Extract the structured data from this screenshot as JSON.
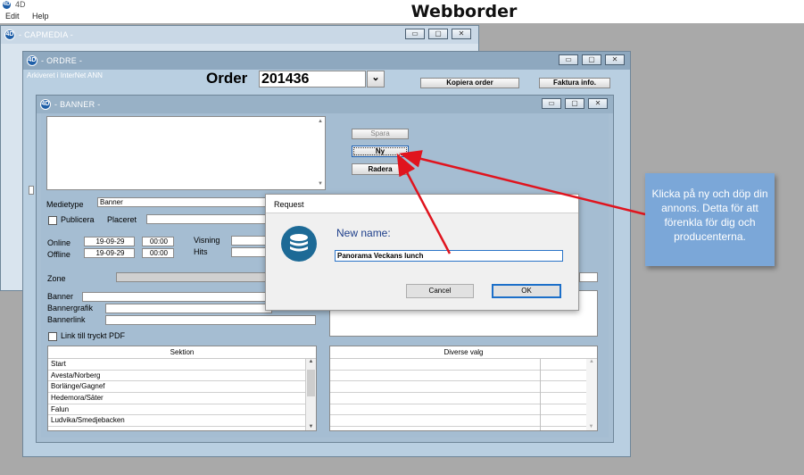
{
  "app": {
    "icon_glyph": "4D",
    "name": "4D",
    "menu": [
      "Edit",
      "Help"
    ]
  },
  "page_title": "Webborder",
  "windows": {
    "capmedia": {
      "title": "- CAPMEDIA -"
    },
    "ordre": {
      "title": "- ORDRE -",
      "archived_label": "Arkiveret i InterNet ANN",
      "order_label": "Order",
      "order_number": "201436",
      "copy_button": "Kopiera order",
      "invoice_button": "Faktura info."
    },
    "banner": {
      "title": "- BANNER -",
      "save_button": "Spara",
      "new_button": "Ny",
      "delete_button": "Radera",
      "medietype_label": "Medietype",
      "medietype_value": "Banner",
      "publicera_label": "Publicera",
      "placeret_label": "Placeret",
      "online_label": "Online",
      "offline_label": "Offline",
      "online_date": "19-09-29",
      "online_time": "00:00",
      "offline_date": "19-09-29",
      "offline_time": "00:00",
      "visning_label": "Visning",
      "hits_label": "Hits",
      "zone_label": "Zone",
      "banner_label": "Banner",
      "bannergrafik_label": "Bannergrafik",
      "bannerlink_label": "Bannerlink",
      "link_pdf_label": "Link till tryckt PDF",
      "sektion_header": "Sektion",
      "sektion_items": [
        "Start",
        "Avesta/Norberg",
        "Borlänge/Gagnef",
        "Hedemora/Säter",
        "Falun",
        "Ludvika/Smedjebacken"
      ],
      "diverse_header": "Diverse valg"
    }
  },
  "dialog": {
    "title": "Request",
    "prompt": "New name:",
    "input_value": "Panorama Veckans lunch",
    "cancel_button": "Cancel",
    "ok_button": "OK"
  },
  "callout": {
    "text": "Klicka på ny och döp din annons. Detta för att förenkla för dig och producenterna."
  },
  "window_controls": {
    "minimize": "▭",
    "maximize": "▢",
    "close": "✕"
  },
  "icons": {
    "scroll_up": "▲",
    "scroll_down": "▼",
    "dropdown": "⌄",
    "database": "database-icon"
  },
  "colors": {
    "arrow": "#e0141e",
    "callout": "#7ba7d8",
    "dialog_icon": "#1d6a96"
  }
}
